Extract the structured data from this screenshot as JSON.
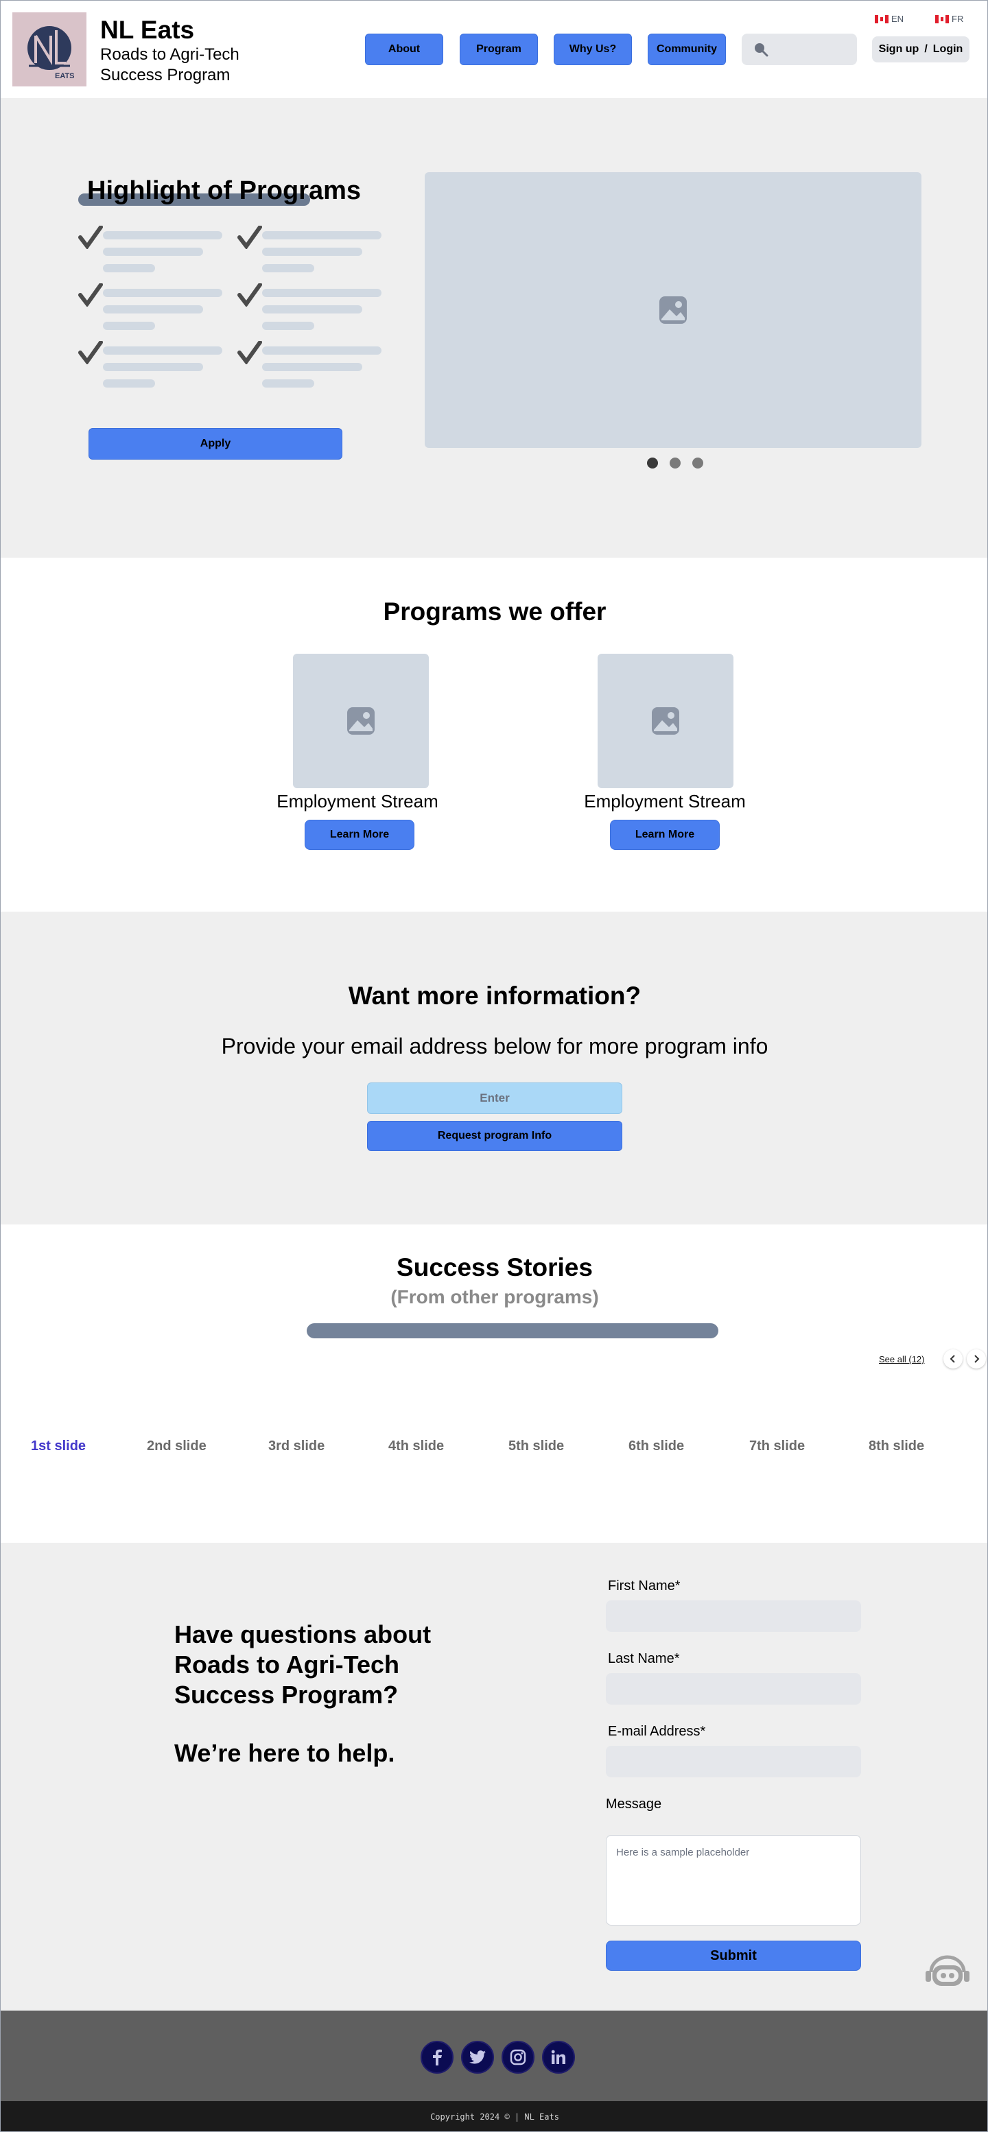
{
  "header": {
    "logo_text": "NL",
    "logo_subtext": "EATS",
    "brand_title": "NL Eats",
    "brand_subtitle": "Roads to Agri-Tech Success Program",
    "nav": {
      "about": "About",
      "program": "Program",
      "why_us": "Why Us?",
      "community": "Community"
    },
    "search_icon": "search-icon",
    "auth": {
      "signup": "Sign up",
      "separator": "/",
      "login": "Login"
    },
    "languages": {
      "en": "EN",
      "fr": "FR"
    }
  },
  "highlight": {
    "title": "Highlight of Programs",
    "apply_label": "Apply",
    "carousel": {
      "active_index": 0,
      "total": 3
    }
  },
  "programs": {
    "title": "Programs we offer",
    "cards": [
      {
        "label": "Employment Stream",
        "button": "Learn More"
      },
      {
        "label": "Employment Stream",
        "button": "Learn More"
      }
    ]
  },
  "info": {
    "title": "Want more information?",
    "subtitle": "Provide your email address below for more program info",
    "email_placeholder": "Enter",
    "button": "Request program Info"
  },
  "stories": {
    "title": "Success Stories",
    "subtitle": "(From other programs)",
    "see_all": "See all (12)",
    "slides": [
      "1st slide",
      "2nd slide",
      "3rd slide",
      "4th slide",
      "5th slide",
      "6th slide",
      "7th slide",
      "8th slide"
    ],
    "active_slide": 0
  },
  "contact": {
    "heading": "Have questions about Roads to Agri-Tech Success Program?",
    "help": "We’re here to help.",
    "first_name_label": "First  Name*",
    "last_name_label": "Last Name*",
    "email_label": "E-mail Address*",
    "message_label": "Message",
    "message_placeholder": "Here is a sample placeholder",
    "submit": "Submit"
  },
  "footer": {
    "social": [
      "facebook-icon",
      "twitter-icon",
      "instagram-icon",
      "linkedin-icon"
    ],
    "copyright": "Copyright 2024 © | NL Eats"
  },
  "colors": {
    "primary": "#4a7ff0",
    "section_gray": "#efefef",
    "placeholder_block": "#d1d9e2",
    "footer": "#5f5f5f",
    "footer_bottom": "#1b1b1b",
    "social_bg": "#0b0b52",
    "active_slide": "#4338ca",
    "email_input": "#aad8f7"
  }
}
